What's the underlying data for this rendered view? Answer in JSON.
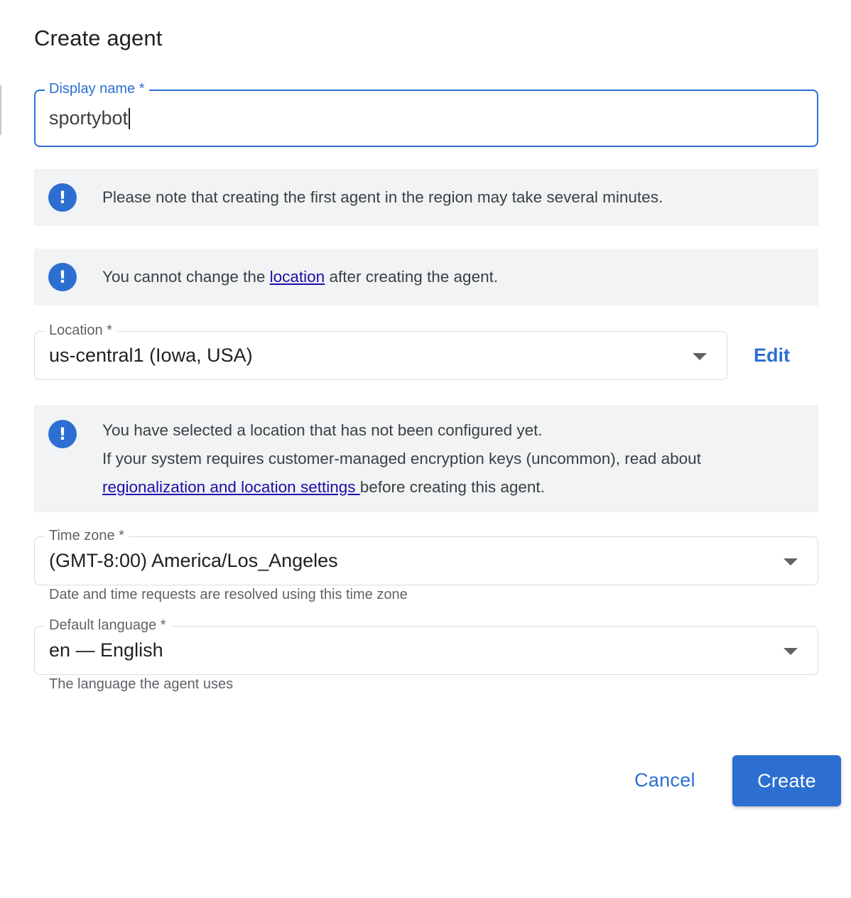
{
  "dialog": {
    "title": "Create agent"
  },
  "display_name": {
    "label": "Display name *",
    "value": "sportybot"
  },
  "notices": {
    "first_agent": {
      "icon": "info-exclamation-icon",
      "text": "Please note that creating the first agent in the region may take several minutes."
    },
    "location_locked": {
      "icon": "info-exclamation-icon",
      "text_before": "You cannot change the ",
      "link": "location",
      "text_after": " after creating the agent."
    },
    "unconfigured": {
      "icon": "info-exclamation-icon",
      "line1": "You have selected a location that has not been configured yet.",
      "line2": "If your system requires customer-managed encryption keys (uncommon), read about",
      "link": "regionalization and location settings ",
      "text_after": "before creating this agent."
    }
  },
  "location": {
    "label": "Location *",
    "value": "us-central1 (Iowa, USA)",
    "edit_label": "Edit"
  },
  "time_zone": {
    "label": "Time zone *",
    "value": "(GMT-8:00) America/Los_Angeles",
    "hint": "Date and time requests are resolved using this time zone"
  },
  "default_language": {
    "label": "Default language *",
    "value": "en — English",
    "hint": "The language the agent uses"
  },
  "actions": {
    "cancel_label": "Cancel",
    "create_label": "Create"
  },
  "colors": {
    "accent": "#2c6fd1",
    "notice_bg": "#f1f3f4",
    "link": "#1a0dab"
  }
}
